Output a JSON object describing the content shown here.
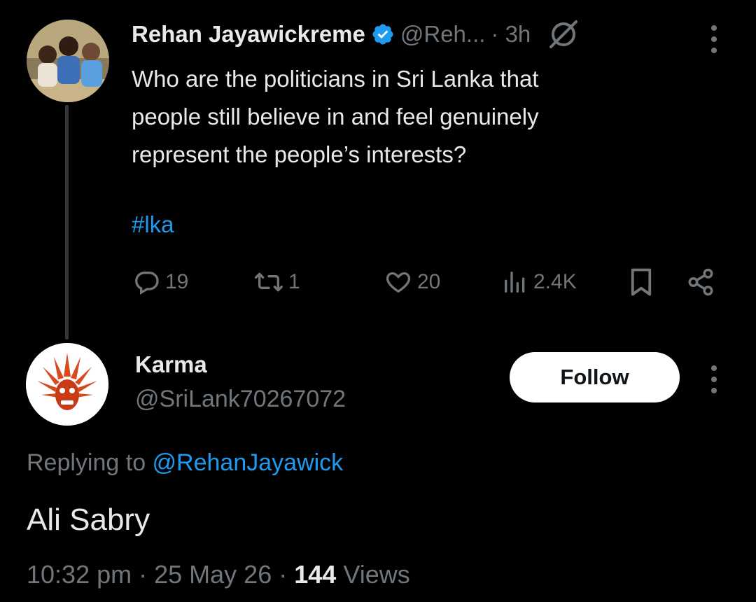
{
  "original_tweet": {
    "author_name": "Rehan Jayawickreme",
    "handle": "@Reh...",
    "time": "· 3h",
    "text": "Who are the politicians in Sri Lanka that\npeople still believe in and feel genuinely\nrepresent the people’s interests?",
    "hashtag": "#lka",
    "replies": "19",
    "reposts": "1",
    "likes": "20",
    "views": "2.4K",
    "verified_color": "#1d9bf0"
  },
  "reply": {
    "author_name": "Karma",
    "handle": "@SriLank70267072",
    "follow_label": "Follow",
    "replying_prefix": "Replying to ",
    "replying_to": "@RehanJayawick",
    "text": "Ali Sabry",
    "time": "10:32 pm",
    "date": "25 May 26",
    "views_count": "144",
    "views_label": "Views"
  },
  "colors": {
    "background": "#000000",
    "accent": "#1d9bf0",
    "muted": "#71767b",
    "text": "#e7e9ea"
  },
  "icons": [
    "verified-badge-icon",
    "grok-icon",
    "more-icon",
    "reply-icon",
    "repost-icon",
    "like-icon",
    "views-icon",
    "bookmark-icon",
    "share-icon"
  ]
}
